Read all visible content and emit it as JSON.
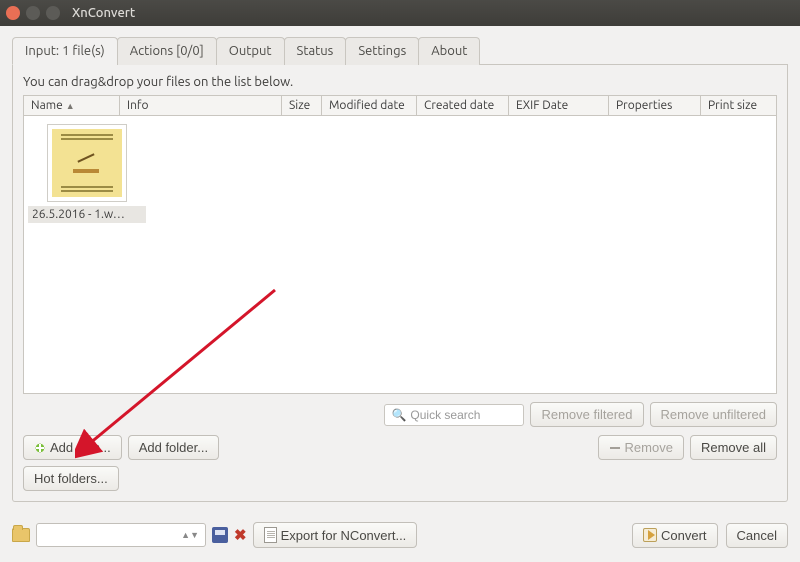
{
  "window": {
    "title": "XnConvert"
  },
  "tabs": [
    {
      "label": "Input: 1 file(s)",
      "active": true
    },
    {
      "label": "Actions [0/0]"
    },
    {
      "label": "Output"
    },
    {
      "label": "Status"
    },
    {
      "label": "Settings"
    },
    {
      "label": "About"
    }
  ],
  "hint": "You can drag&drop your files on the list below.",
  "columns": {
    "name": "Name",
    "info": "Info",
    "size": "Size",
    "modified": "Modified date",
    "created": "Created date",
    "exif": "EXIF Date",
    "properties": "Properties",
    "printsize": "Print size"
  },
  "files": [
    {
      "name": "26.5.2016 - 1.w…"
    }
  ],
  "toolbar": {
    "search_placeholder": "Quick search",
    "remove_filtered": "Remove filtered",
    "remove_unfiltered": "Remove unfiltered",
    "add_files": "Add files...",
    "add_folder": "Add folder...",
    "remove": "Remove",
    "remove_all": "Remove all",
    "hot_folders": "Hot folders..."
  },
  "footer": {
    "export": "Export for NConvert...",
    "convert": "Convert",
    "cancel": "Cancel"
  }
}
